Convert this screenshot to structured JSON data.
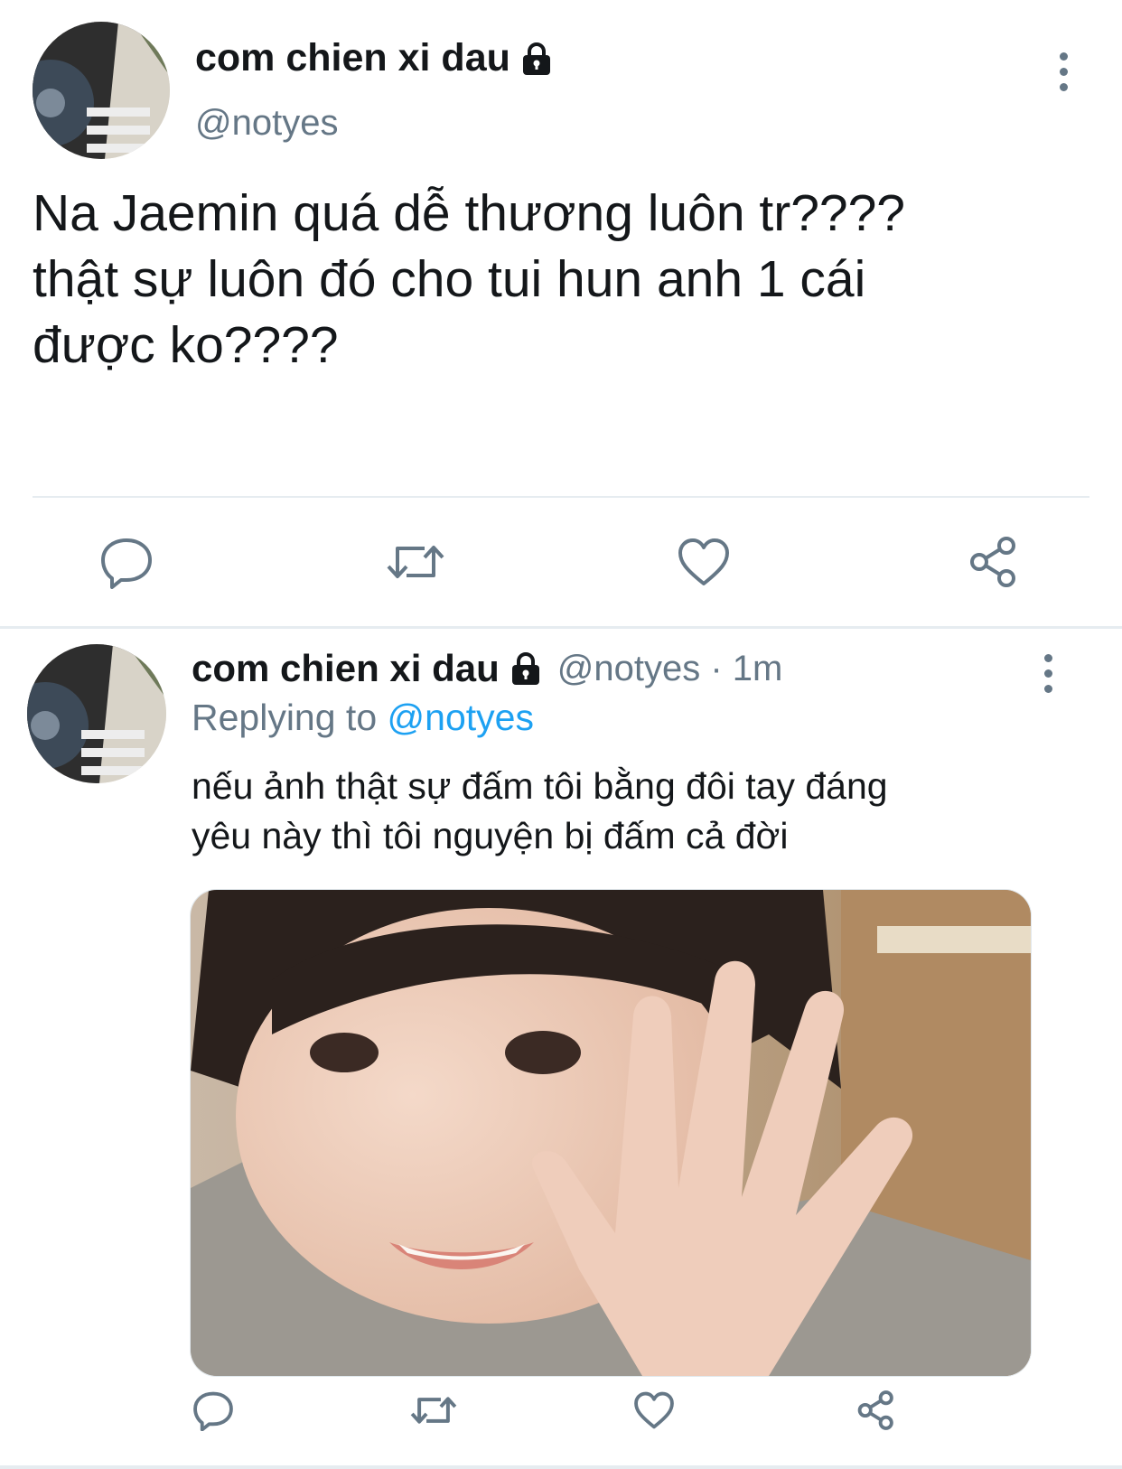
{
  "colors": {
    "text_primary": "#14171a",
    "text_secondary": "#657786",
    "link": "#1da1f2",
    "divider": "#e6ecf0"
  },
  "main_tweet": {
    "display_name": "com chien xi dau",
    "handle": "@notyes",
    "protected_icon": "lock-icon",
    "text": "Na Jaemin quá dễ thương luôn tr????\nthật sự luôn đó cho tui hun anh 1 cái\nđược ko????",
    "actions": [
      "reply-icon",
      "retweet-icon",
      "like-icon",
      "share-icon"
    ]
  },
  "reply_tweet": {
    "display_name": "com chien xi dau",
    "protected_icon": "lock-icon",
    "meta": "@notyes · 1m",
    "replying_label": "Replying to",
    "replying_mention": "@notyes",
    "text": "nếu ảnh thật sự đấm tôi bằng đôi tay đáng\nyêu này thì tôi nguyện bị đấm cả đời",
    "media": "photo",
    "actions": [
      "reply-icon",
      "retweet-icon",
      "like-icon",
      "share-icon"
    ]
  }
}
